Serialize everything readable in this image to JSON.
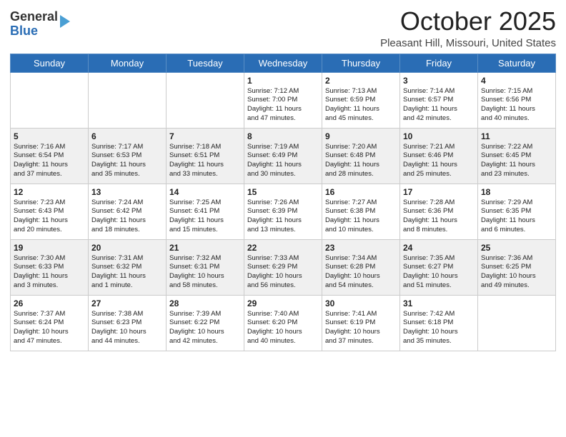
{
  "header": {
    "logo_general": "General",
    "logo_blue": "Blue",
    "month": "October 2025",
    "location": "Pleasant Hill, Missouri, United States"
  },
  "days_of_week": [
    "Sunday",
    "Monday",
    "Tuesday",
    "Wednesday",
    "Thursday",
    "Friday",
    "Saturday"
  ],
  "weeks": [
    [
      {
        "day": "",
        "info": ""
      },
      {
        "day": "",
        "info": ""
      },
      {
        "day": "",
        "info": ""
      },
      {
        "day": "1",
        "info": "Sunrise: 7:12 AM\nSunset: 7:00 PM\nDaylight: 11 hours\nand 47 minutes."
      },
      {
        "day": "2",
        "info": "Sunrise: 7:13 AM\nSunset: 6:59 PM\nDaylight: 11 hours\nand 45 minutes."
      },
      {
        "day": "3",
        "info": "Sunrise: 7:14 AM\nSunset: 6:57 PM\nDaylight: 11 hours\nand 42 minutes."
      },
      {
        "day": "4",
        "info": "Sunrise: 7:15 AM\nSunset: 6:56 PM\nDaylight: 11 hours\nand 40 minutes."
      }
    ],
    [
      {
        "day": "5",
        "info": "Sunrise: 7:16 AM\nSunset: 6:54 PM\nDaylight: 11 hours\nand 37 minutes."
      },
      {
        "day": "6",
        "info": "Sunrise: 7:17 AM\nSunset: 6:53 PM\nDaylight: 11 hours\nand 35 minutes."
      },
      {
        "day": "7",
        "info": "Sunrise: 7:18 AM\nSunset: 6:51 PM\nDaylight: 11 hours\nand 33 minutes."
      },
      {
        "day": "8",
        "info": "Sunrise: 7:19 AM\nSunset: 6:49 PM\nDaylight: 11 hours\nand 30 minutes."
      },
      {
        "day": "9",
        "info": "Sunrise: 7:20 AM\nSunset: 6:48 PM\nDaylight: 11 hours\nand 28 minutes."
      },
      {
        "day": "10",
        "info": "Sunrise: 7:21 AM\nSunset: 6:46 PM\nDaylight: 11 hours\nand 25 minutes."
      },
      {
        "day": "11",
        "info": "Sunrise: 7:22 AM\nSunset: 6:45 PM\nDaylight: 11 hours\nand 23 minutes."
      }
    ],
    [
      {
        "day": "12",
        "info": "Sunrise: 7:23 AM\nSunset: 6:43 PM\nDaylight: 11 hours\nand 20 minutes."
      },
      {
        "day": "13",
        "info": "Sunrise: 7:24 AM\nSunset: 6:42 PM\nDaylight: 11 hours\nand 18 minutes."
      },
      {
        "day": "14",
        "info": "Sunrise: 7:25 AM\nSunset: 6:41 PM\nDaylight: 11 hours\nand 15 minutes."
      },
      {
        "day": "15",
        "info": "Sunrise: 7:26 AM\nSunset: 6:39 PM\nDaylight: 11 hours\nand 13 minutes."
      },
      {
        "day": "16",
        "info": "Sunrise: 7:27 AM\nSunset: 6:38 PM\nDaylight: 11 hours\nand 10 minutes."
      },
      {
        "day": "17",
        "info": "Sunrise: 7:28 AM\nSunset: 6:36 PM\nDaylight: 11 hours\nand 8 minutes."
      },
      {
        "day": "18",
        "info": "Sunrise: 7:29 AM\nSunset: 6:35 PM\nDaylight: 11 hours\nand 6 minutes."
      }
    ],
    [
      {
        "day": "19",
        "info": "Sunrise: 7:30 AM\nSunset: 6:33 PM\nDaylight: 11 hours\nand 3 minutes."
      },
      {
        "day": "20",
        "info": "Sunrise: 7:31 AM\nSunset: 6:32 PM\nDaylight: 11 hours\nand 1 minute."
      },
      {
        "day": "21",
        "info": "Sunrise: 7:32 AM\nSunset: 6:31 PM\nDaylight: 10 hours\nand 58 minutes."
      },
      {
        "day": "22",
        "info": "Sunrise: 7:33 AM\nSunset: 6:29 PM\nDaylight: 10 hours\nand 56 minutes."
      },
      {
        "day": "23",
        "info": "Sunrise: 7:34 AM\nSunset: 6:28 PM\nDaylight: 10 hours\nand 54 minutes."
      },
      {
        "day": "24",
        "info": "Sunrise: 7:35 AM\nSunset: 6:27 PM\nDaylight: 10 hours\nand 51 minutes."
      },
      {
        "day": "25",
        "info": "Sunrise: 7:36 AM\nSunset: 6:25 PM\nDaylight: 10 hours\nand 49 minutes."
      }
    ],
    [
      {
        "day": "26",
        "info": "Sunrise: 7:37 AM\nSunset: 6:24 PM\nDaylight: 10 hours\nand 47 minutes."
      },
      {
        "day": "27",
        "info": "Sunrise: 7:38 AM\nSunset: 6:23 PM\nDaylight: 10 hours\nand 44 minutes."
      },
      {
        "day": "28",
        "info": "Sunrise: 7:39 AM\nSunset: 6:22 PM\nDaylight: 10 hours\nand 42 minutes."
      },
      {
        "day": "29",
        "info": "Sunrise: 7:40 AM\nSunset: 6:20 PM\nDaylight: 10 hours\nand 40 minutes."
      },
      {
        "day": "30",
        "info": "Sunrise: 7:41 AM\nSunset: 6:19 PM\nDaylight: 10 hours\nand 37 minutes."
      },
      {
        "day": "31",
        "info": "Sunrise: 7:42 AM\nSunset: 6:18 PM\nDaylight: 10 hours\nand 35 minutes."
      },
      {
        "day": "",
        "info": ""
      }
    ]
  ]
}
